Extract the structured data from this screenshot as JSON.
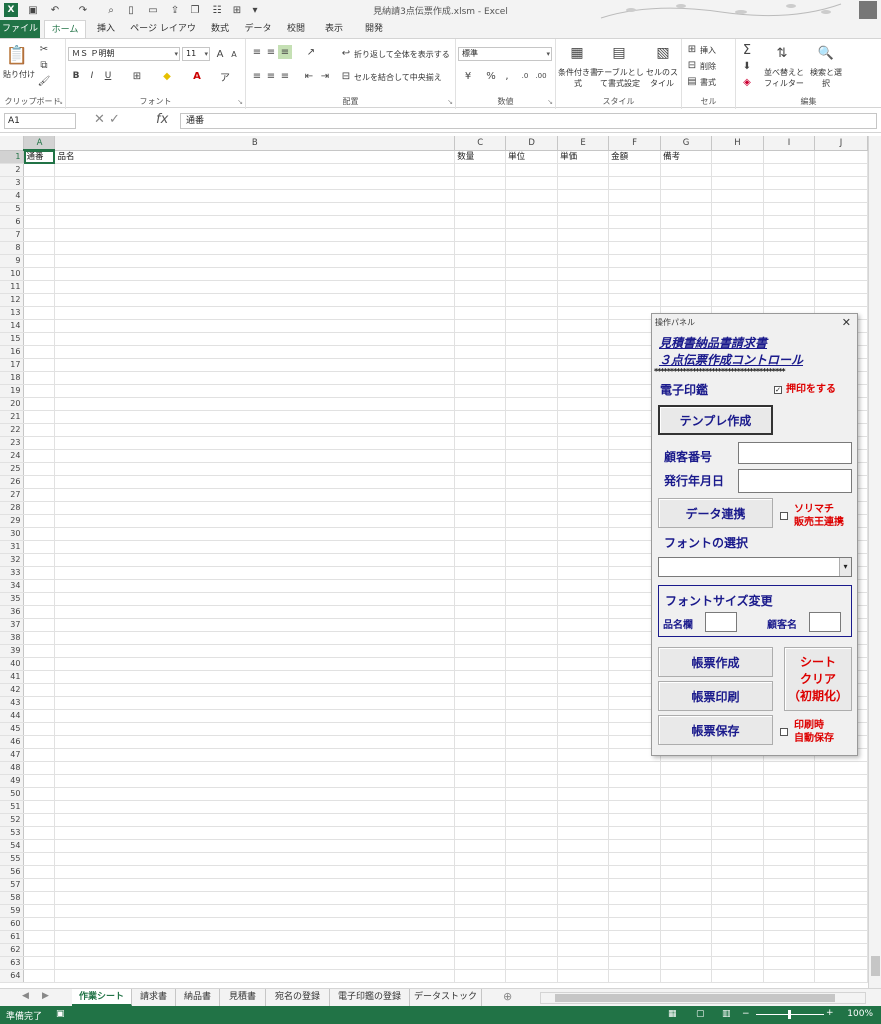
{
  "window": {
    "title": "見納請3点伝票作成.xlsm - Excel"
  },
  "tabs": [
    "ファイル",
    "ホーム",
    "挿入",
    "ページ レイアウト",
    "数式",
    "データ",
    "校閲",
    "表示",
    "開発"
  ],
  "ribbon": {
    "clipboard": {
      "paste": "貼り付け",
      "label": "クリップボード"
    },
    "font": {
      "name": "ＭＳ Ｐ明朝",
      "size": "11",
      "bold": "B",
      "italic": "I",
      "underline": "U",
      "label": "フォント"
    },
    "align": {
      "wrap": "折り返して全体を表示する",
      "merge": "セルを結合して中央揃え",
      "label": "配置"
    },
    "number": {
      "format": "標準",
      "percent": "%",
      "comma": ",",
      "label": "数値"
    },
    "styles": {
      "cond": "条件付き書式",
      "table": "テーブルとして書式設定",
      "cell": "セルのスタイル",
      "label": "スタイル"
    },
    "cells": {
      "insert": "挿入",
      "delete": "削除",
      "format": "書式",
      "label": "セル"
    },
    "edit": {
      "sort": "並べ替えとフィルター",
      "find": "検索と選択",
      "label": "編集"
    }
  },
  "formula_bar": {
    "name_box": "A1",
    "fx": "fx",
    "content": "通番"
  },
  "sheet": {
    "columns": [
      "A",
      "B",
      "C",
      "D",
      "E",
      "F",
      "G",
      "H",
      "I",
      "J"
    ],
    "header_row": [
      "通番",
      "品名",
      "数量",
      "単位",
      "単価",
      "金額",
      "備考",
      "",
      "",
      ""
    ],
    "row_count": 64
  },
  "sheet_tabs": [
    "作業シート",
    "請求書",
    "納品書",
    "見積書",
    "宛名の登録",
    "電子印鑑の登録",
    "データストック"
  ],
  "status": {
    "text": "準備完了",
    "zoom": "100%"
  },
  "panel": {
    "window_title": "操作パネル",
    "title_line1": "見積書納品書請求書",
    "title_line2": "３点伝票作成コントロール",
    "stars": "*****************************************",
    "stamp_label": "電子印鑑",
    "stamp_check": "押印をする",
    "template_button": "テンプレ作成",
    "customer_no_label": "顧客番号",
    "issue_date_label": "発行年月日",
    "data_link_button": "データ連携",
    "sorimachi_line1": "ソリマチ",
    "sorimachi_line2": "販売王連携",
    "font_select_label": "フォントの選択",
    "font_size_label": "フォントサイズ変更",
    "item_col_label": "品名欄",
    "customer_name_label": "顧客名",
    "create_button": "帳票作成",
    "print_button": "帳票印刷",
    "save_button": "帳票保存",
    "clear_line1": "シート",
    "clear_line2": "クリア",
    "clear_line3": "（初期化）",
    "autosave_line1": "印刷時",
    "autosave_line2": "自動保存"
  }
}
